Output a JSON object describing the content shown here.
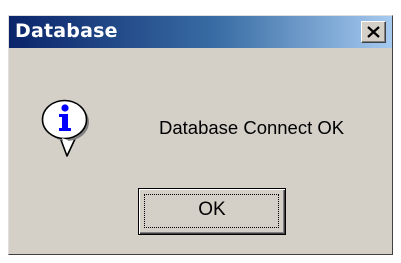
{
  "window": {
    "title": "Database",
    "close_icon": "close-icon"
  },
  "content": {
    "icon": "info-icon",
    "message": "Database Connect OK"
  },
  "buttons": {
    "ok_label": "OK"
  },
  "colors": {
    "title_bar_start": "#0a246a",
    "title_bar_end": "#a6caf0",
    "dialog_face": "#d4d0c8",
    "icon_blue": "#0000ff"
  }
}
